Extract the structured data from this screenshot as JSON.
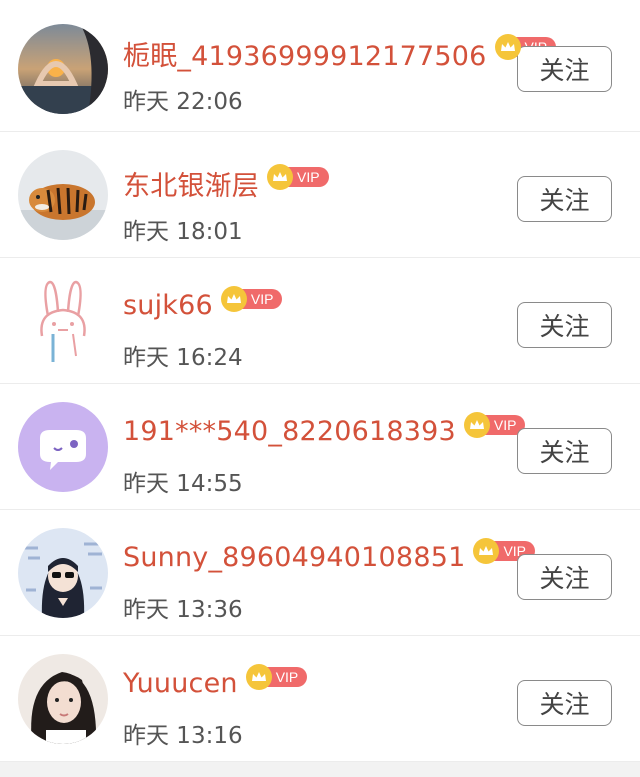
{
  "users": [
    {
      "name": "栀眠_41936999912177506",
      "time": "昨天 22:06",
      "vip": "VIP",
      "follow": "关注",
      "avatar": "sunset-hands-avatar"
    },
    {
      "name": "东北银渐层",
      "time": "昨天 18:01",
      "vip": "VIP",
      "follow": "关注",
      "avatar": "tiger-avatar"
    },
    {
      "name": "sujk66",
      "time": "昨天 16:24",
      "vip": "VIP",
      "follow": "关注",
      "avatar": "bunny-avatar"
    },
    {
      "name": "191***540_8220618393",
      "time": "昨天 14:55",
      "vip": "VIP",
      "follow": "关注",
      "avatar": "chat-bubble-avatar"
    },
    {
      "name": "Sunny_89604940108851",
      "time": "昨天 13:36",
      "vip": "VIP",
      "follow": "关注",
      "avatar": "anime-girl-avatar"
    },
    {
      "name": "Yuuucen",
      "time": "昨天 13:16",
      "vip": "VIP",
      "follow": "关注",
      "avatar": "girl-photo-avatar"
    }
  ],
  "colors": {
    "name": "#d3513a",
    "vip_badge": "#f06a6a",
    "crown": "#f5c53a"
  }
}
